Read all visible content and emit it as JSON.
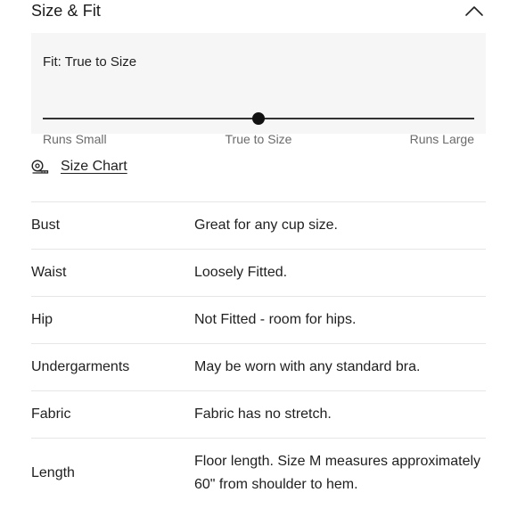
{
  "header": {
    "title": "Size & Fit",
    "collapse_icon": "chevron-up-icon"
  },
  "fit": {
    "label": "Fit: True to Size",
    "scale": [
      "Runs Small",
      "True to Size",
      "Runs Large"
    ],
    "position_fraction": 0.5
  },
  "size_chart": {
    "label": "Size Chart",
    "icon": "measuring-tape-icon"
  },
  "specs": [
    {
      "label": "Bust",
      "value": "Great for any cup size."
    },
    {
      "label": "Waist",
      "value": "Loosely Fitted."
    },
    {
      "label": "Hip",
      "value": "Not Fitted - room for hips."
    },
    {
      "label": "Undergarments",
      "value": "May be worn with any standard bra."
    },
    {
      "label": "Fabric",
      "value": "Fabric has no stretch."
    },
    {
      "label": "Length",
      "value": "Floor length. Size M measures approximately 60\" from shoulder to hem."
    }
  ]
}
